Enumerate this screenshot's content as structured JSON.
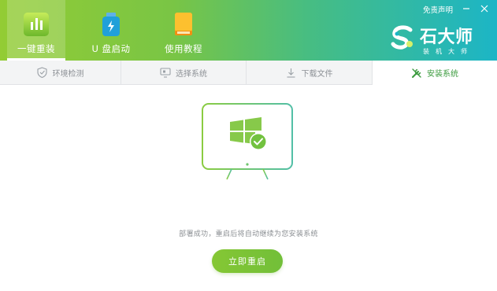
{
  "header": {
    "nav": [
      {
        "label": "一键重装",
        "icon": "bar-chart-icon",
        "active": true
      },
      {
        "label": "U 盘启动",
        "icon": "usb-drive-icon",
        "active": false
      },
      {
        "label": "使用教程",
        "icon": "book-icon",
        "active": false
      }
    ],
    "disclaimer": "免责声明",
    "brand": {
      "name": "石大师",
      "subtitle": "装机大师"
    }
  },
  "steps": [
    {
      "label": "环境检测",
      "icon": "shield-icon",
      "active": false
    },
    {
      "label": "选择系统",
      "icon": "monitor-icon",
      "active": false
    },
    {
      "label": "下载文件",
      "icon": "download-icon",
      "active": false
    },
    {
      "label": "安装系统",
      "icon": "wrench-icon",
      "active": true
    }
  ],
  "main": {
    "message": "部署成功，重启后将自动继续为您安装系统",
    "action_label": "立即重启"
  },
  "colors": {
    "accent": "#7dc43c",
    "brand_gradient_start": "#93cc34",
    "brand_gradient_end": "#1cb5c6",
    "active_step": "#3c9b3f"
  }
}
